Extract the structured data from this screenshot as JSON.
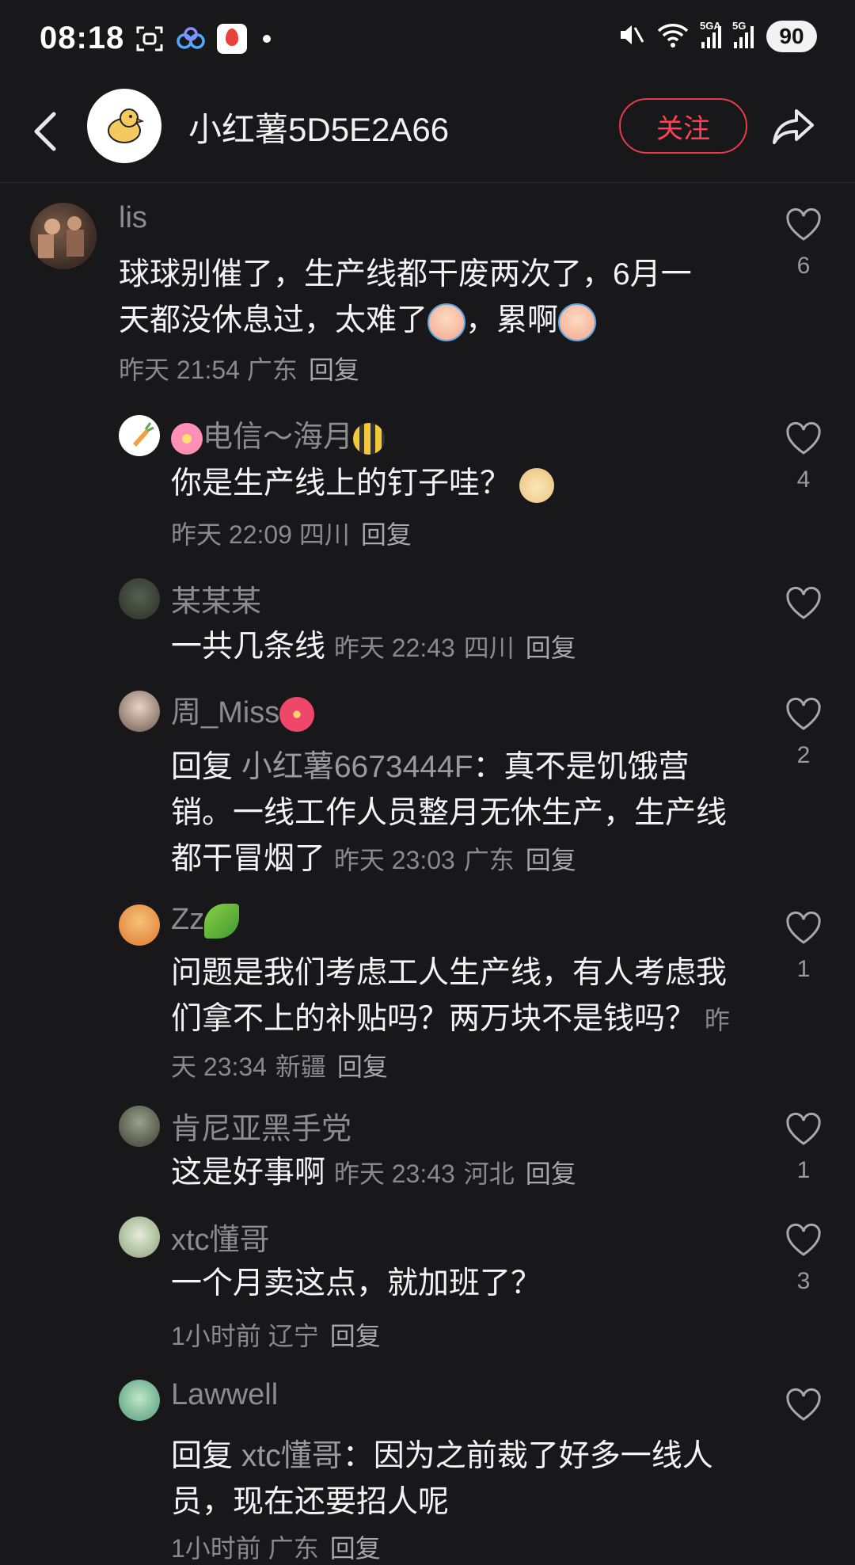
{
  "status": {
    "time": "08:18",
    "network_1": "5GA",
    "network_2": "5G",
    "battery": "90"
  },
  "header": {
    "username": "小红薯5D5E2A66",
    "follow_label": "关注"
  },
  "comments": [
    {
      "name": "lis",
      "text": "球球别催了，生产线都干废两次了，6月一天都没休息过，太难了",
      "text_tail": "，累啊",
      "time": "昨天 21:54",
      "location": "广东",
      "reply": "回复",
      "likes": "6"
    },
    {
      "name": "电信～海月",
      "text": "你是生产线上的钉子哇？",
      "time": "昨天 22:09",
      "location": "四川",
      "reply": "回复",
      "likes": "4"
    },
    {
      "name": "某某某",
      "text": "一共几条线",
      "time": "昨天 22:43",
      "location": "四川",
      "reply": "回复",
      "likes": ""
    },
    {
      "name": "周_Miss",
      "reply_prefix": "回复",
      "mention": "小红薯6673444F",
      "text": "：真不是饥饿营销。一线工作人员整月无休生产，生产线都干冒烟了",
      "time": "昨天 23:03",
      "location": "广东",
      "reply": "回复",
      "likes": "2"
    },
    {
      "name": "Zz",
      "text": "问题是我们考虑工人生产线，有人考虑我们拿不上的补贴吗？两万块不是钱吗？",
      "time": "昨天 23:34",
      "location": "新疆",
      "reply": "回复",
      "likes": "1"
    },
    {
      "name": "肯尼亚黑手党",
      "text": "这是好事啊",
      "time": "昨天 23:43",
      "location": "河北",
      "reply": "回复",
      "likes": "1"
    },
    {
      "name": "xtc懂哥",
      "text": "一个月卖这点，就加班了？",
      "time": "1小时前",
      "location": "辽宁",
      "reply": "回复",
      "likes": "3"
    },
    {
      "name": "Lawwell",
      "reply_prefix": "回复",
      "mention": "xtc懂哥",
      "text": "：因为之前裁了好多一线人员，现在还要招人呢",
      "time": "1小时前",
      "location": "广东",
      "reply": "回复",
      "likes": ""
    }
  ],
  "icons": {
    "back": "chevron-left-icon",
    "share": "share-arrow-icon",
    "like": "heart-outline-icon"
  }
}
